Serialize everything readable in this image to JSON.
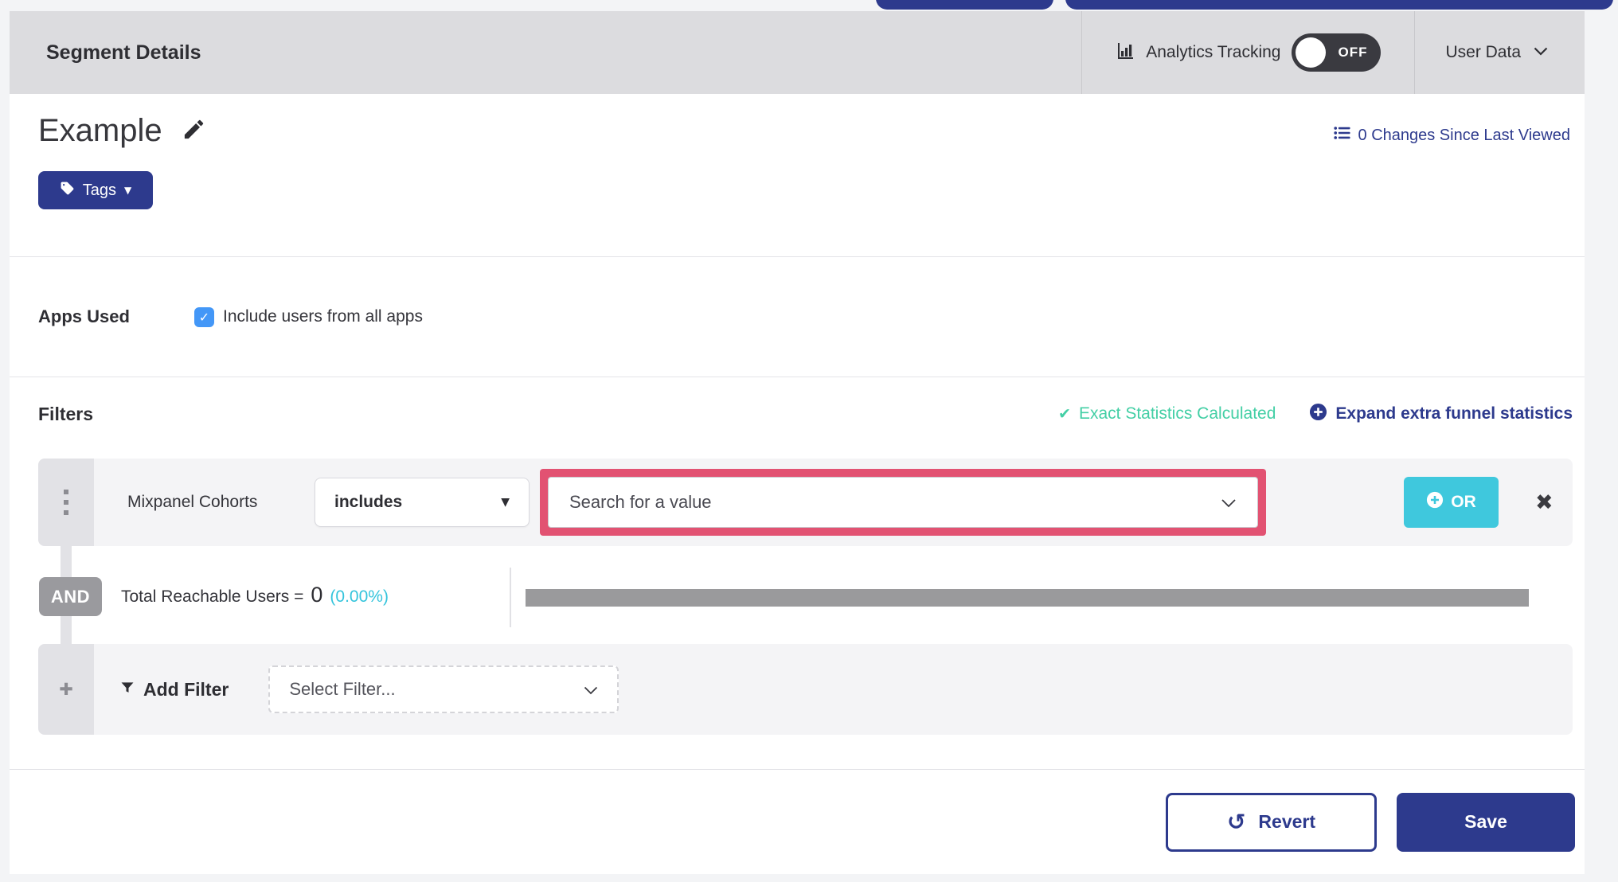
{
  "colors": {
    "navy": "#2d3a8d",
    "cyan": "#3fc8dd",
    "teal_success": "#43cfa5",
    "highlight_pink": "#e25272",
    "checkbox_blue": "#4397f7",
    "badge_gray": "#9a9a9e",
    "header_band_gray": "#dcdcdf"
  },
  "icons": {
    "caret_down_glyph": "▼",
    "check_glyph": "✔",
    "checkbox_check_glyph": "✓",
    "close_glyph": "✖",
    "plus_glyph": "✚",
    "revert_glyph": "↺"
  },
  "header": {
    "title": "Segment Details",
    "analytics_tracking": {
      "label": "Analytics Tracking",
      "toggle_state": "OFF"
    },
    "user_data": {
      "label": "User Data"
    }
  },
  "segment": {
    "name": "Example",
    "changes_link": "0 Changes Since Last Viewed",
    "tags_button_label": "Tags"
  },
  "apps_used": {
    "label": "Apps Used",
    "include_all_label": "Include users from all apps",
    "include_all_checked": true
  },
  "filters": {
    "title": "Filters",
    "exact_statistics_label": "Exact Statistics Calculated",
    "expand_link_label": "Expand extra funnel statistics",
    "rows": [
      {
        "field": "Mixpanel Cohorts",
        "operator": "includes",
        "value_placeholder": "Search for a value",
        "or_button_label": "OR"
      }
    ],
    "conjunction_label": "AND",
    "total_reachable": {
      "prefix": "Total Reachable Users =",
      "count": "0",
      "percent": "(0.00%)"
    },
    "add_filter": {
      "label": "Add Filter",
      "select_placeholder": "Select Filter..."
    }
  },
  "footer": {
    "revert_label": "Revert",
    "save_label": "Save"
  }
}
